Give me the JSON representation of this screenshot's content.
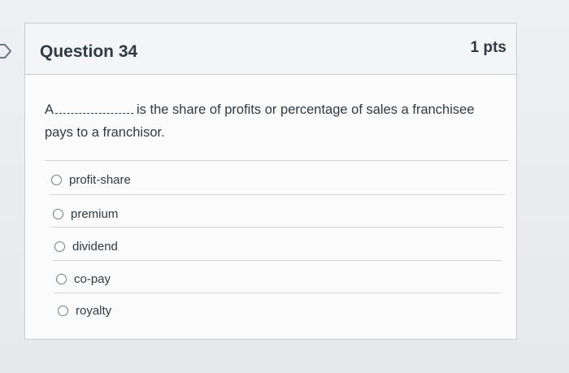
{
  "question": {
    "title": "Question 34",
    "points": "1 pts",
    "text_before_blank": "A",
    "text_after_blank": "is the share of profits or percentage of sales a franchisee",
    "text_line2": "pays to a franchisor."
  },
  "answers": [
    {
      "label": "profit-share"
    },
    {
      "label": "premium"
    },
    {
      "label": "dividend"
    },
    {
      "label": "co-pay"
    },
    {
      "label": "royalty"
    }
  ],
  "colors": {
    "text": "#2d3b45",
    "header_bg": "#f4f5f7",
    "border": "#c7cdd1"
  }
}
